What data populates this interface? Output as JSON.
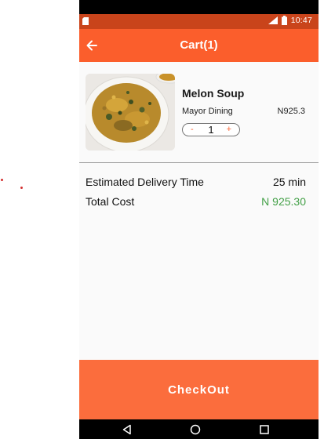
{
  "status_bar": {
    "time": "10:47",
    "icons": [
      "sd-card-icon",
      "signal-icon",
      "battery-icon"
    ]
  },
  "app_bar": {
    "title": "Cart(1)",
    "back_icon": "arrow-left-icon"
  },
  "cart_item": {
    "name": "Melon Soup",
    "vendor": "Mayor Dining",
    "price": "N925.3",
    "quantity": "1",
    "decrement_label": "-",
    "increment_label": "+",
    "image": "melon-soup-bowl-image"
  },
  "summary": {
    "delivery_label": "Estimated Delivery Time",
    "delivery_value": "25 min",
    "total_label": "Total Cost",
    "total_value": "N 925.30"
  },
  "checkout": {
    "label": "CheckOut"
  },
  "nav_bar": {
    "icons": [
      "back-triangle-icon",
      "home-circle-icon",
      "recents-square-icon"
    ]
  },
  "colors": {
    "primary": "#fb5e2c",
    "status_bar": "#c9441b",
    "checkout": "#fb6d3d",
    "total_green": "#43a047"
  }
}
